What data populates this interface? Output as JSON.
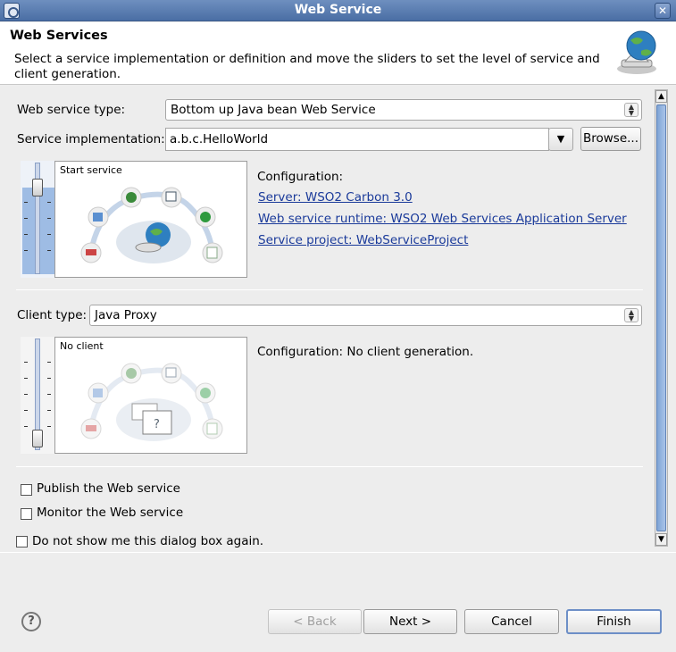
{
  "window": {
    "title": "Web Service"
  },
  "header": {
    "title": "Web Services",
    "description": "Select a service implementation or definition and move the sliders to set the level of service and client generation."
  },
  "service": {
    "type_label": "Web service type:",
    "type_value": "Bottom up Java bean Web Service",
    "impl_label": "Service implementation:",
    "impl_value": "a.b.c.HelloWorld",
    "browse_label": "Browse...",
    "slider_caption": "Start service",
    "slider_level": "Start service",
    "config_heading": "Configuration:",
    "config_links": [
      "Server: WSO2 Carbon 3.0",
      "Web service runtime: WSO2 Web Services Application Server",
      "Service project: WebServiceProject"
    ]
  },
  "client": {
    "type_label": "Client type:",
    "type_value": "Java Proxy",
    "slider_caption": "No client",
    "slider_level": "No client",
    "config_text": "Configuration: No client generation."
  },
  "options": {
    "publish_label": "Publish the Web service",
    "publish_checked": false,
    "monitor_label": "Monitor the Web service",
    "monitor_checked": false,
    "dont_show_label": "Do not show me this dialog box again.",
    "dont_show_checked": false
  },
  "buttons": {
    "back": "< Back",
    "next": "Next >",
    "cancel": "Cancel",
    "finish": "Finish",
    "help": "?"
  },
  "colors": {
    "titlebar": "#4a6ea4",
    "link": "#1a3a9a",
    "accent": "#9ebce4"
  },
  "icons": [
    "web-service-globe-icon",
    "help-icon",
    "close-icon",
    "eclipse-window-icon",
    "lifecycle-diagram-icon"
  ]
}
